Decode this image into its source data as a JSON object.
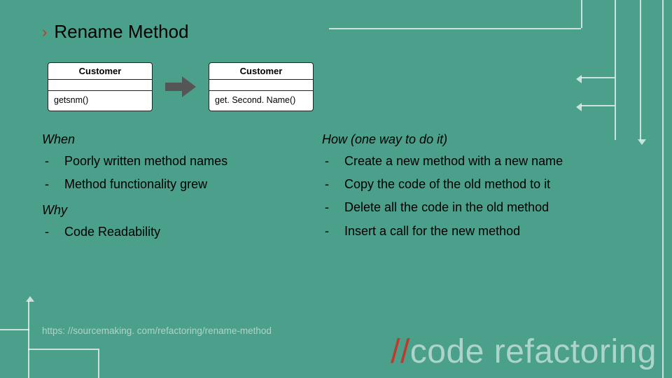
{
  "title": {
    "bullet": "›",
    "text": "Rename Method"
  },
  "uml": {
    "left": {
      "header": "Customer",
      "method": "getsnm()"
    },
    "right": {
      "header": "Customer",
      "method": "get. Second. Name()"
    }
  },
  "sections": {
    "when": {
      "heading": "When",
      "items": [
        "Poorly written method names",
        "Method functionality grew"
      ]
    },
    "why": {
      "heading": "Why",
      "items": [
        "Code Readability"
      ]
    },
    "how": {
      "heading": "How (one way to do it)",
      "items": [
        "Create a new method with a new name",
        "Copy the code of the old method to it",
        "Delete all the code in the old method",
        "Insert a call for the new method"
      ]
    }
  },
  "footer": "https: //sourcemaking. com/refactoring/rename-method",
  "watermark": {
    "slashes": "//",
    "text": "code refactoring"
  }
}
